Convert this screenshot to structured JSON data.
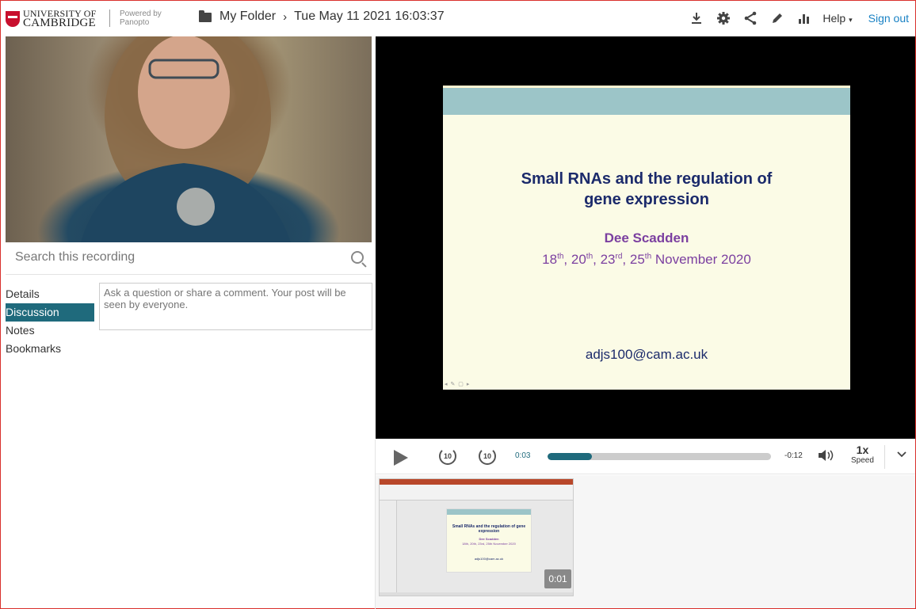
{
  "header": {
    "university_line1": "UNIVERSITY OF",
    "university_line2": "CAMBRIDGE",
    "powered_line1": "Powered by",
    "powered_line2": "Panopto",
    "folder": "My Folder",
    "session": "Tue May 11 2021 16:03:37",
    "help_label": "Help",
    "signout_label": "Sign out",
    "tools": [
      "download-icon",
      "settings-icon",
      "share-icon",
      "edit-icon",
      "stats-icon"
    ]
  },
  "search": {
    "placeholder": "Search this recording"
  },
  "tabs": [
    "Details",
    "Discussion",
    "Notes",
    "Bookmarks"
  ],
  "active_tab": "Discussion",
  "discussion": {
    "placeholder": "Ask a question or share a comment. Your post will be seen by everyone."
  },
  "slide": {
    "title_line1": "Small RNAs and the regulation of",
    "title_line2": "gene expression",
    "author": "Dee Scadden",
    "dates": {
      "d1": "18",
      "s1": "th",
      "d2": "20",
      "s2": "th",
      "d3": "23",
      "s3": "rd",
      "d4": "25",
      "s4": "th",
      "rest": "November 2020"
    },
    "email": "adjs100@cam.ac.uk"
  },
  "controls": {
    "skip_back": "10",
    "skip_forward": "10",
    "current_time": "0:03",
    "remaining_time": "-0:12",
    "progress": 0.2,
    "speed_value": "1x",
    "speed_label": "Speed"
  },
  "thumbnail": {
    "time": "0:01",
    "title": "Small RNAs and the regulation of gene expression",
    "author": "Dee Scadden",
    "dates": "18th, 20th, 23rd, 25th November 2020",
    "email": "adjs100@cam.ac.uk"
  },
  "colors": {
    "accent": "#1f6a7c",
    "link": "#1a82c4",
    "brand": "#c8102e"
  }
}
